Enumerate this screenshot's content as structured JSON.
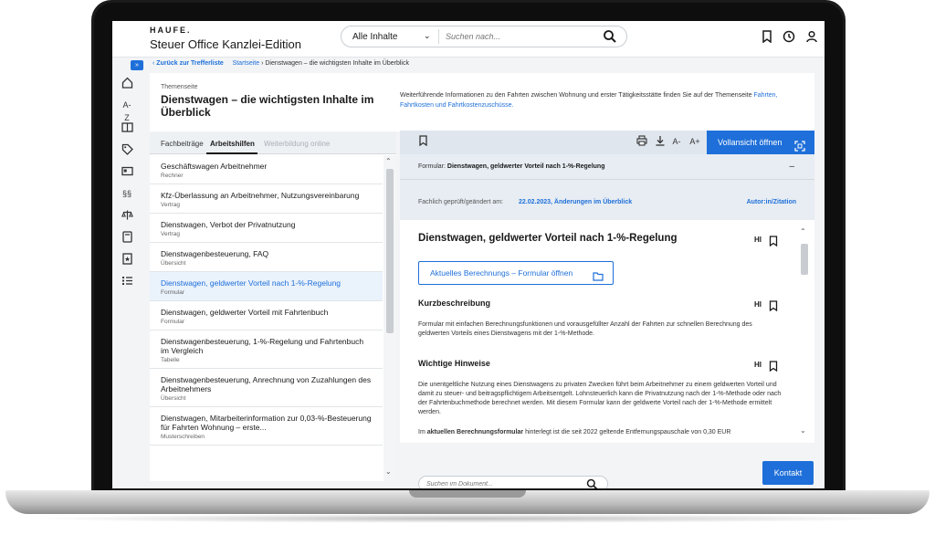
{
  "header": {
    "brand": "HAUFE.",
    "product": "Steuer Office Kanzlei-Edition",
    "search_scope": "Alle Inhalte",
    "search_placeholder": "Suchen nach..."
  },
  "breadcrumb": {
    "back": "Zurück zur Trefferliste",
    "home": "Startseite",
    "current": "Dienstwagen – die wichtigsten Inhalte im Überblick"
  },
  "hero": {
    "kicker": "Themenseite",
    "title": "Dienstwagen – die wichtigsten Inhalte im Überblick",
    "text": "Weiterführende Informationen zu den Fahrten zwischen Wohnung und erster Tätigkeitsstätte finden Sie auf der Themenseite",
    "link": "Fahrten, Fahrtkosten und Fahrtkostenzuschüsse."
  },
  "nav": {
    "toggle": "»",
    "az_label": "A-Z",
    "paragraph_label": "§§"
  },
  "left_tabs": [
    "Fachbeiträge",
    "Arbeitshilfen",
    "Weiterbildung online"
  ],
  "list_items": [
    {
      "title": "Geschäftswagen Arbeitnehmer",
      "type": "Rechner"
    },
    {
      "title": "Kfz-Überlassung an Arbeitnehmer, Nutzungsvereinbarung",
      "type": "Vertrag"
    },
    {
      "title": "Dienstwagen, Verbot der Privatnutzung",
      "type": "Vertrag"
    },
    {
      "title": "Dienstwagenbesteuerung, FAQ",
      "type": "Übersicht"
    },
    {
      "title": "Dienstwagen, geldwerter Vorteil nach 1-%-Regelung",
      "type": "Formular"
    },
    {
      "title": "Dienstwagen, geldwerter Vorteil mit Fahrtenbuch",
      "type": "Formular"
    },
    {
      "title": "Dienstwagenbesteuerung, 1-%-Regelung und Fahrtenbuch im Vergleich",
      "type": "Tabelle"
    },
    {
      "title": "Dienstwagenbesteuerung, Anrechnung von Zuzahlungen des Arbeitnehmers",
      "type": "Übersicht"
    },
    {
      "title": "Dienstwagen, Mitarbeiterinformation zur 0,03-%-Besteuerung für Fahrten Wohnung – erste...",
      "type": "Musterschreiben"
    }
  ],
  "toolbar": {
    "font_smaller": "A-",
    "font_larger": "A+",
    "fullview": "Vollansicht öffnen"
  },
  "formbar": {
    "prefix": "Formular:",
    "title": "Dienstwagen, geldwerter Vorteil nach 1-%-Regelung",
    "collapse": "–"
  },
  "meta": {
    "label": "Fachlich geprüft/geändert am:",
    "value": "22.02.2023, Änderungen im Überblick",
    "author": "Autor:in/Zitation"
  },
  "doc": {
    "title": "Dienstwagen, geldwerter Vorteil nach 1-%-Regelung",
    "hl": "HI",
    "calc_button": "Aktuelles Berechnungs – Formular öffnen",
    "section1_title": "Kurzbeschreibung",
    "section1_text": "Formular mit einfachen Berechnungsfunktionen und vorausgefüllter Anzahl der Fahrten zur schnellen Berechnung des geldwerten Vorteils eines Dienstwagens mit der 1-%-Methode.",
    "section2_title": "Wichtige Hinweise",
    "section2_text": "Die unentgeltliche Nutzung eines Dienstwagens zu privaten Zwecken führt beim Arbeitnehmer zu einem geldwerten Vorteil und damit zu steuer- und beitragspflichtigem Arbeitsentgelt. Lohnsteuerlich kann die Privatnutzung nach der 1-%-Methode oder nach der Fahrtenbuchmethode berechnet werden. Mit diesem Formular kann der geldwerte Vorteil nach der 1-%-Methode ermittelt werden.",
    "section2_text2_a": "Im ",
    "section2_text2_b": "aktuellen Berechnungsformular",
    "section2_text2_c": " hinterlegt ist die seit 2022 geltende Entfernungspauschale von 0,30 EUR",
    "search_placeholder": "Suchen im Dokument..."
  },
  "contact": "Kontakt",
  "colors": {
    "accent": "#1e6fd9",
    "panel": "#dfe6ee"
  }
}
